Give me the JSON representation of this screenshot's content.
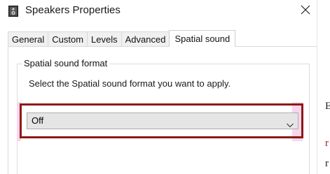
{
  "window": {
    "title": "Speakers Properties",
    "icon": "speaker-icon",
    "close_icon": "close-icon"
  },
  "tabs": [
    {
      "label": "General",
      "active": false
    },
    {
      "label": "Custom",
      "active": false
    },
    {
      "label": "Levels",
      "active": false
    },
    {
      "label": "Advanced",
      "active": false
    },
    {
      "label": "Spatial sound",
      "active": true
    }
  ],
  "spatial": {
    "group_label": "Spatial sound format",
    "instruction": "Select the Spatial sound format you want to apply.",
    "format_select": {
      "value": "Off",
      "icon": "chevron-down-icon"
    }
  },
  "edge": {
    "glyphs": [
      "E",
      "r",
      "r"
    ]
  },
  "colors": {
    "highlight_border": "#8c1a18",
    "highlight_tint": "#f8d7ec",
    "select_background": "#e5e5e5"
  }
}
